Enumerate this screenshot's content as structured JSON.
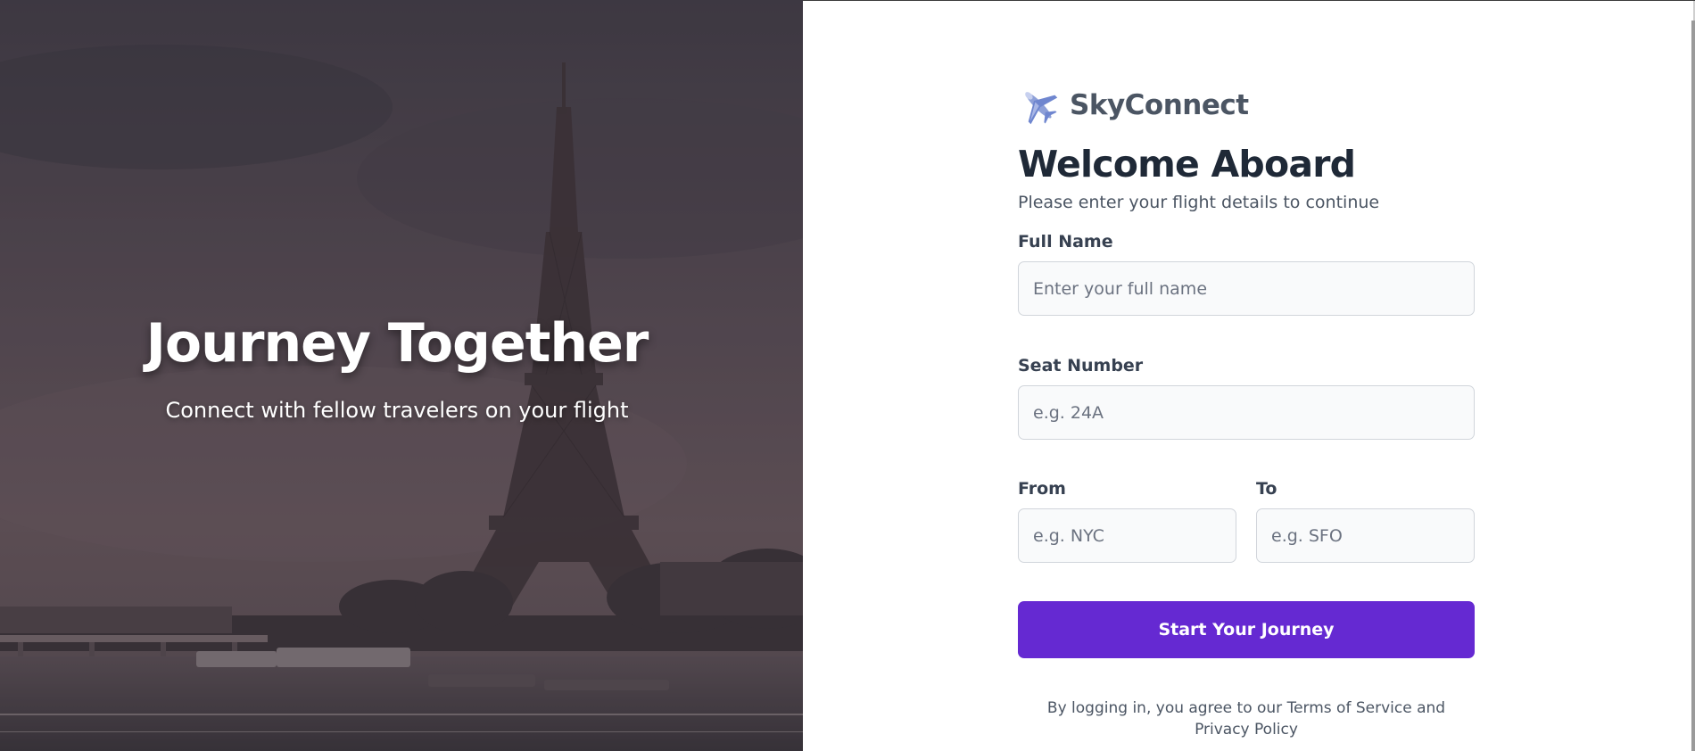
{
  "hero": {
    "title": "Journey Together",
    "subtitle": "Connect with fellow travelers on your flight"
  },
  "brand": {
    "icon": "airplane-icon",
    "name": "SkyConnect",
    "accent": "#6529d2"
  },
  "form": {
    "heading": "Welcome Aboard",
    "subheading": "Please enter your flight details to continue",
    "full_name": {
      "label": "Full Name",
      "placeholder": "Enter your full name",
      "value": ""
    },
    "seat_number": {
      "label": "Seat Number",
      "placeholder": "e.g. 24A",
      "value": ""
    },
    "from": {
      "label": "From",
      "placeholder": "e.g. NYC",
      "value": ""
    },
    "to": {
      "label": "To",
      "placeholder": "e.g. SFO",
      "value": ""
    },
    "submit_label": "Start Your Journey",
    "terms": "By logging in, you agree to our Terms of Service and Privacy Policy"
  },
  "colors": {
    "button": "#6529d2",
    "heading": "#1f2937",
    "muted": "#4b5563",
    "field_bg": "#f9fafb",
    "field_border": "#d1d5db"
  }
}
